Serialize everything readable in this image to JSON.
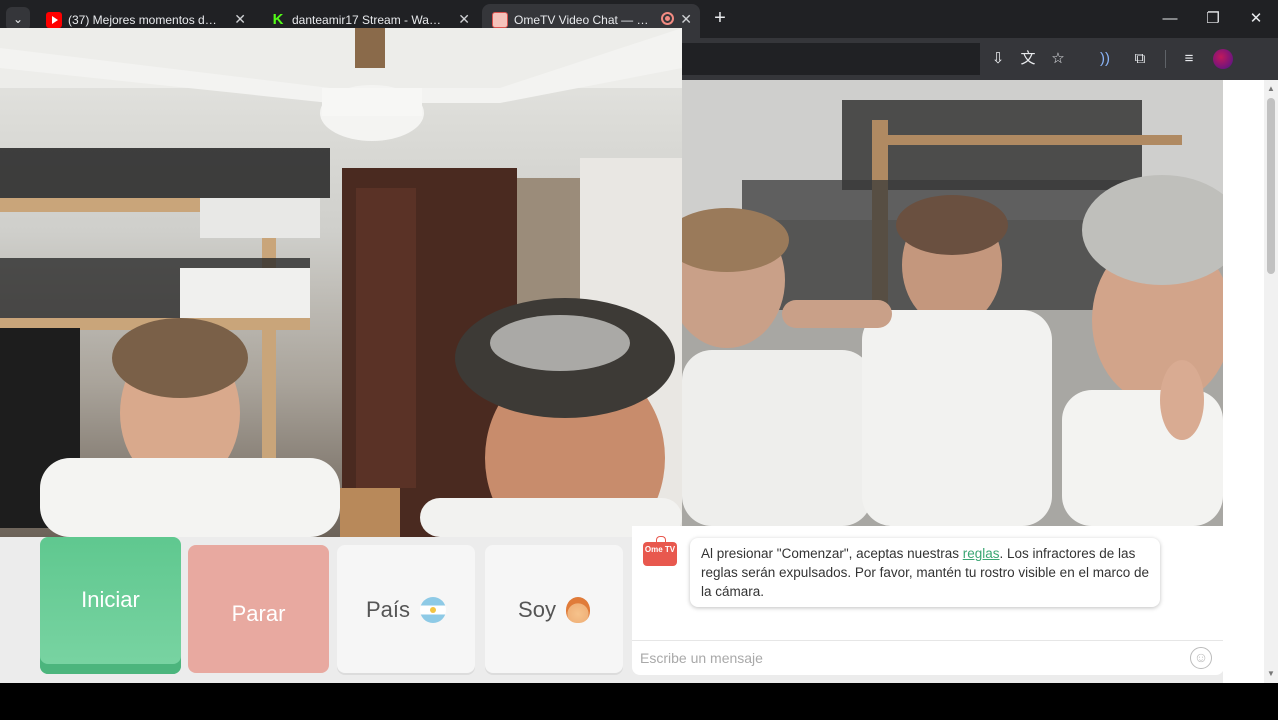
{
  "browser": {
    "tabs": [
      {
        "title": "(37) Mejores momentos de Ene",
        "favicon": "youtube-icon"
      },
      {
        "title": "danteamir17 Stream - Watch Li",
        "favicon": "kick-icon"
      },
      {
        "title": "OmeTV Video Chat — Ome",
        "favicon": "ometv-icon",
        "active": true,
        "recording": true
      }
    ],
    "window_controls": [
      "minimize",
      "restore",
      "close"
    ]
  },
  "controls": {
    "start_label": "Iniciar",
    "stop_label": "Parar",
    "country_label": "País",
    "soy_label": "Soy"
  },
  "chat": {
    "logo_text": "Ome TV",
    "system_message_before": "Al presionar \"Comenzar\", aceptas nuestras ",
    "system_message_link": "reglas",
    "system_message_after": ". Los infractores de las reglas serán expulsados. Por favor, mantén tu rostro visible en el marco de la cámara.",
    "input_placeholder": "Escribe un mensaje"
  },
  "colors": {
    "start": "#5fc88f",
    "stop": "#e8a9a0",
    "accent_link": "#3aa673",
    "brand": "#e8584e"
  }
}
